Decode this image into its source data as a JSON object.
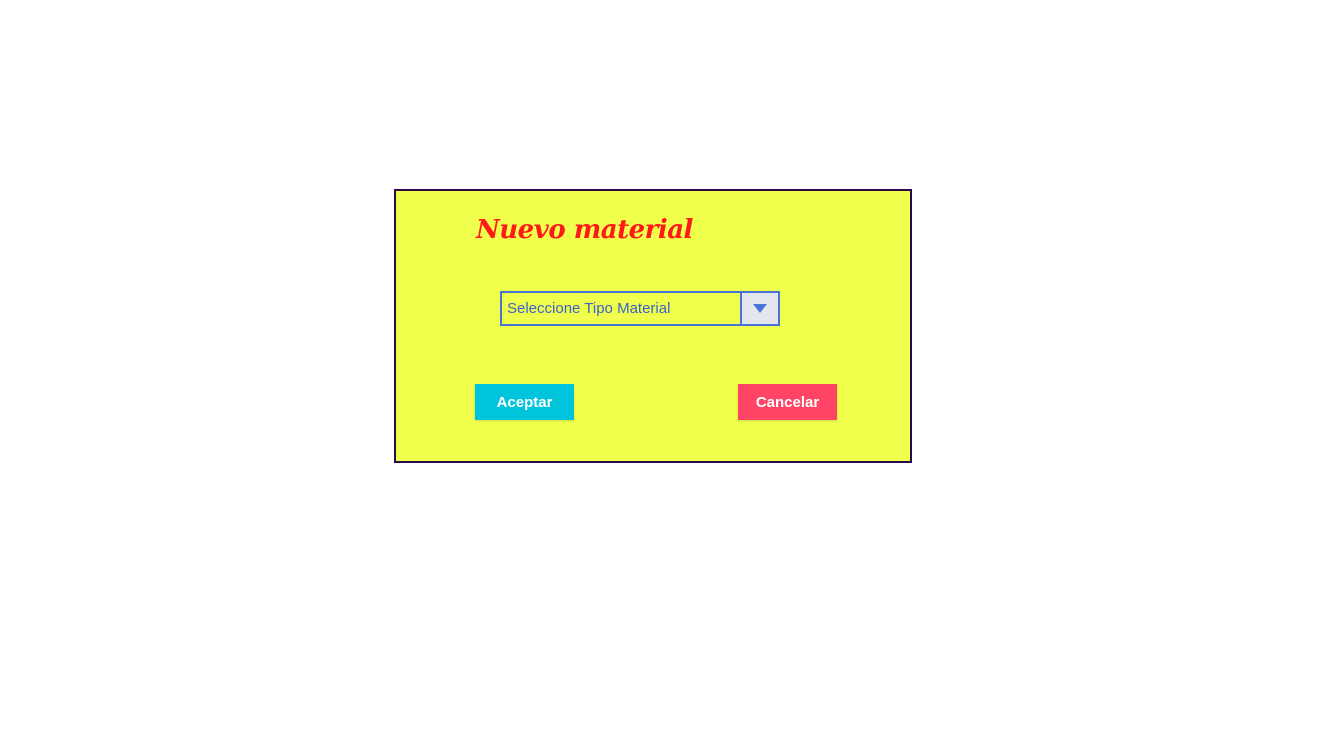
{
  "dialog": {
    "title": "Nuevo material",
    "material_type_select": {
      "placeholder": "Seleccione Tipo Material"
    },
    "accept_label": "Aceptar",
    "cancel_label": "Cancelar"
  },
  "colors": {
    "dialog_background": "#f0ff4c",
    "dialog_border": "#2a0a4a",
    "title": "#ff1a1a",
    "select_border": "#4a74d8",
    "accept_button": "#00c3dc",
    "cancel_button": "#ff4466"
  },
  "icons": {
    "dropdown": "triangle-down-icon"
  }
}
